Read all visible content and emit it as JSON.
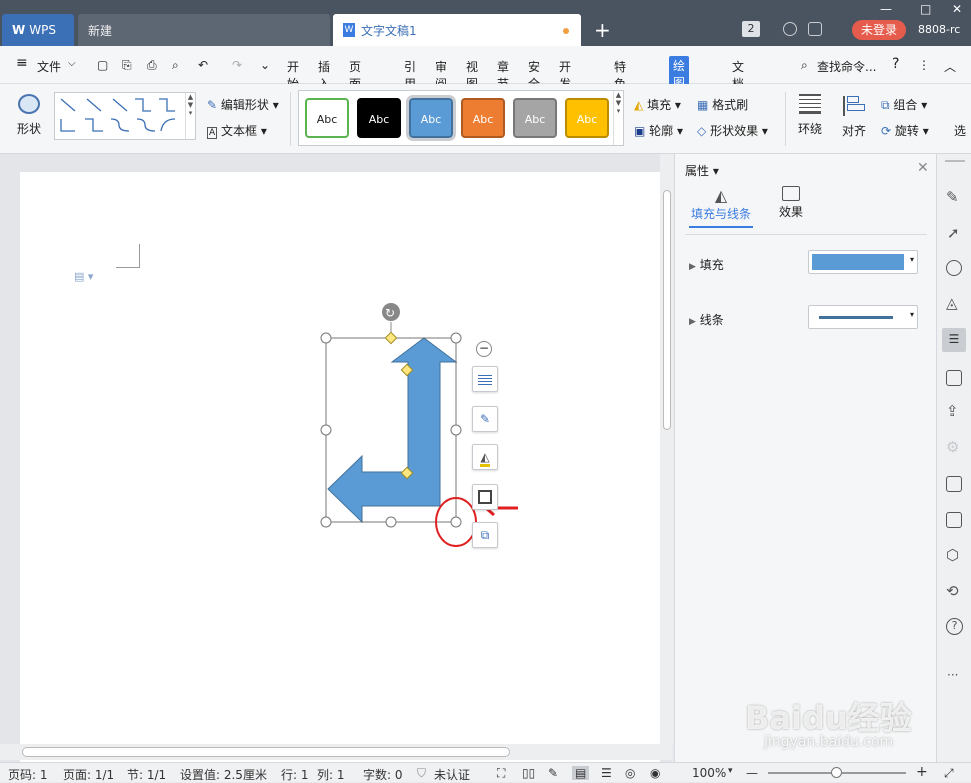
{
  "tabs": {
    "wps": "WPS",
    "new": "新建",
    "doc": "文字文稿1",
    "add": "+",
    "count": "2",
    "login": "未登录",
    "account": "8808-rc"
  },
  "menubar": {
    "file": "文件",
    "items": [
      "开始",
      "插入",
      "页面布局",
      "引用",
      "审阅",
      "视图",
      "章节",
      "安全",
      "开发工具",
      "特色应用",
      "绘图工具",
      "文档助手"
    ],
    "active": "绘图工具",
    "search": "查找命令...",
    "help": "?"
  },
  "ribbon": {
    "shape": "形状",
    "edit_shape": "编辑形状",
    "textbox": "文本框",
    "styles": [
      {
        "label": "Abc",
        "bg": "#ffffff",
        "fg": "#222222",
        "border": "#5bb450"
      },
      {
        "label": "Abc",
        "bg": "#000000",
        "fg": "#ffffff",
        "border": "#000000"
      },
      {
        "label": "Abc",
        "bg": "#5b9bd5",
        "fg": "#ffffff",
        "border": "#41719c"
      },
      {
        "label": "Abc",
        "bg": "#ed7d31",
        "fg": "#ffffff",
        "border": "#ae5a21"
      },
      {
        "label": "Abc",
        "bg": "#a5a5a5",
        "fg": "#ffffff",
        "border": "#787878"
      },
      {
        "label": "Abc",
        "bg": "#ffc000",
        "fg": "#ffffff",
        "border": "#bc8c00"
      }
    ],
    "fill": "填充",
    "format_painter": "格式刷",
    "outline": "轮廓",
    "shape_effect": "形状效果",
    "wrap": "环绕",
    "align": "对齐",
    "group": "组合",
    "rotate": "旋转",
    "select": "选"
  },
  "panel": {
    "title": "属性",
    "tab_fill": "填充与线条",
    "tab_effect": "效果",
    "fill": "填充",
    "line": "线条",
    "fill_color": "#5b9bd5",
    "line_color": "#41719c"
  },
  "statusbar": {
    "page_no": "页码: 1",
    "page": "页面: 1/1",
    "section": "节: 1/1",
    "setting": "设置值: 2.5厘米",
    "row": "行: 1",
    "col": "列: 1",
    "words": "字数: 0",
    "cert": "未认证",
    "zoom": "100%"
  },
  "watermark": {
    "brand": "Baidu经验",
    "url": "jingyan.baidu.com"
  }
}
